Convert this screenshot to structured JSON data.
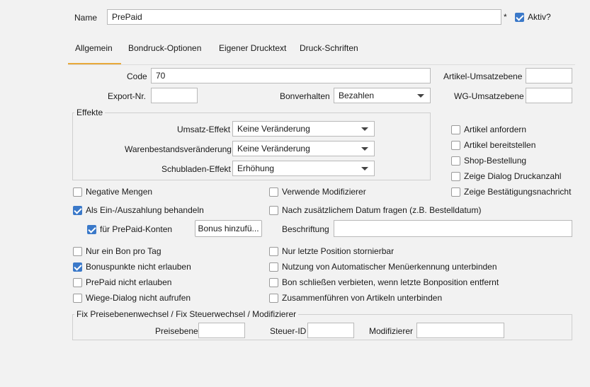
{
  "header": {
    "name_label": "Name",
    "name_value": "PrePaid",
    "required_star": "*",
    "active_label": "Aktiv?",
    "active_checked": true
  },
  "tabs": [
    {
      "label": "Allgemein",
      "active": true
    },
    {
      "label": "Bondruck-Optionen",
      "active": false
    },
    {
      "label": "Eigener Drucktext",
      "active": false
    },
    {
      "label": "Druck-Schriften",
      "active": false
    }
  ],
  "general": {
    "code_label": "Code",
    "code_value": "70",
    "export_label": "Export-Nr.",
    "export_value": "",
    "bonverhalten_label": "Bonverhalten",
    "bonverhalten_value": "Bezahlen",
    "artikel_umsatz_label": "Artikel-Umsatzebene",
    "artikel_umsatz_value": "",
    "wg_umsatz_label": "WG-Umsatzebene",
    "wg_umsatz_value": ""
  },
  "effekte": {
    "title": "Effekte",
    "umsatz_label": "Umsatz-Effekt",
    "umsatz_value": "Keine Veränderung",
    "warenbestand_label": "Warenbestandsveränderung",
    "warenbestand_value": "Keine Veränderung",
    "schubladen_label": "Schubladen-Effekt",
    "schubladen_value": "Erhöhung"
  },
  "right_checks": [
    {
      "label": "Artikel anfordern",
      "checked": false
    },
    {
      "label": "Artikel bereitstellen",
      "checked": false
    },
    {
      "label": "Shop-Bestellung",
      "checked": false
    },
    {
      "label": "Zeige Dialog Druckanzahl",
      "checked": false
    },
    {
      "label": "Zeige Bestätigungsnachricht",
      "checked": false
    }
  ],
  "checks": {
    "negative_mengen": {
      "label": "Negative Mengen",
      "checked": false
    },
    "ein_auszahlung": {
      "label": "Als Ein-/Auszahlung behandeln",
      "checked": true
    },
    "prepaid_konten": {
      "label": "für PrePaid-Konten",
      "checked": true
    },
    "verwende_modifizierer": {
      "label": "Verwende Modifizierer",
      "checked": false
    },
    "datum_fragen": {
      "label": "Nach zusätzlichem Datum fragen (z.B. Bestelldatum)",
      "checked": false
    },
    "ein_bon": {
      "label": "Nur ein Bon pro Tag",
      "checked": false
    },
    "bonuspunkte": {
      "label": "Bonuspunkte nicht erlauben",
      "checked": true
    },
    "prepaid_nicht": {
      "label": "PrePaid nicht erlauben",
      "checked": false
    },
    "wiege_dialog": {
      "label": "Wiege-Dialog nicht aufrufen",
      "checked": false
    },
    "letzte_position": {
      "label": "Nur letzte Position stornierbar",
      "checked": false
    },
    "menuerkennung": {
      "label": "Nutzung von Automatischer Menüerkennung unterbinden",
      "checked": false
    },
    "bon_schliessen": {
      "label": "Bon schließen verbieten, wenn letzte Bonposition entfernt",
      "checked": false
    },
    "zusammenfuehren": {
      "label": "Zusammenführen von Artikeln unterbinden",
      "checked": false
    }
  },
  "bonus_button": "Bonus hinzufü...",
  "beschriftung_label": "Beschriftung",
  "beschriftung_value": "",
  "fix": {
    "title": "Fix Preisebenenwechsel / Fix Steuerwechsel / Modifizierer",
    "preisebene_label": "Preisebene",
    "preisebene_value": "",
    "steuer_label": "Steuer-ID",
    "steuer_value": "",
    "modifizierer_label": "Modifizierer",
    "modifizierer_value": ""
  }
}
